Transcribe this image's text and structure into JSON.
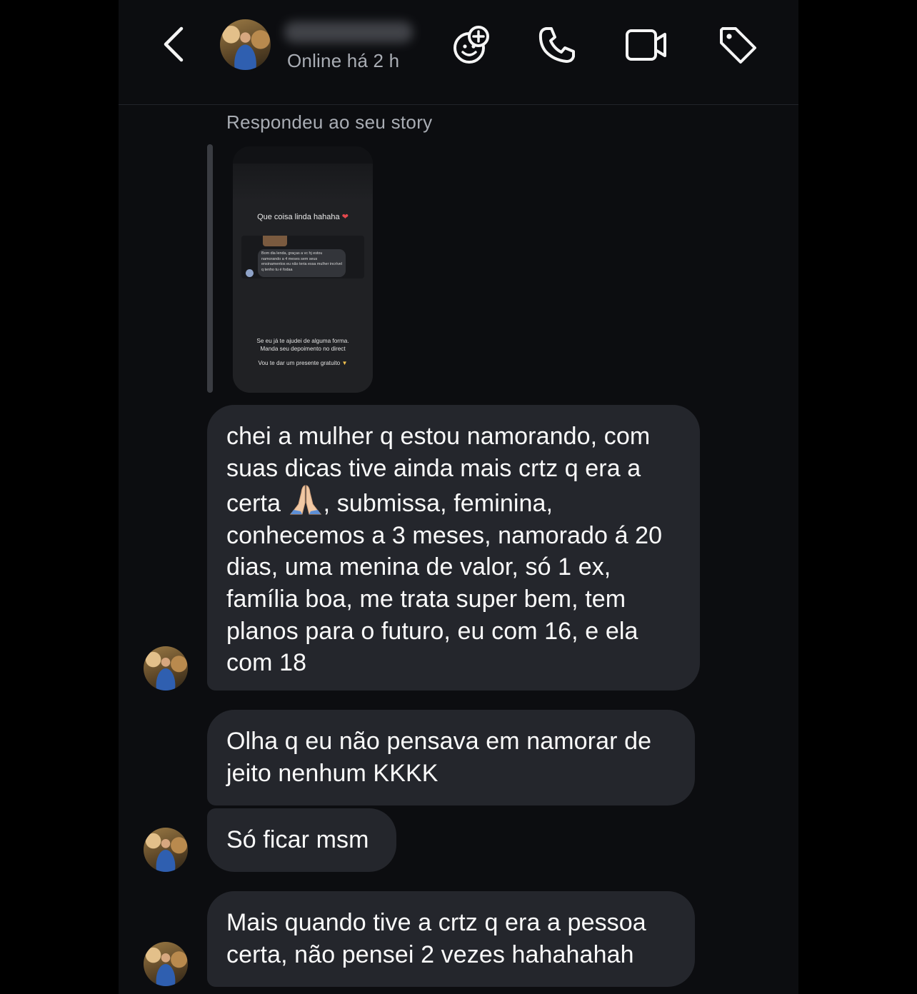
{
  "header": {
    "status": "Online há 2 h",
    "icons": [
      "back-chevron-icon",
      "add-effect-icon",
      "phone-icon",
      "video-call-icon",
      "tag-icon"
    ]
  },
  "reply": {
    "label": "Respondeu ao seu story"
  },
  "story": {
    "title": "Que coisa linda hahaha",
    "dm_text": "Bom dia lenda, graças a vc hj estou namorando a 4 meses sem seus ensinamentos eu não teria essa mulher incrível q tenho tu é fodaa",
    "footer_line1": "Se eu já te ajudei de alguma forma.",
    "footer_line2": "Manda seu depoimento no direct",
    "footer_line3": "Vou te dar um presente gratuito"
  },
  "messages": [
    {
      "before": "chei a mulher q estou namorando, com suas dicas tive ainda mais crtz q era a certa",
      "emoji": "folded-hands",
      "after": ", submissa, feminina, conhecemos a 3 meses, namorado á 20 dias, uma menina de valor, só 1 ex, família boa, me trata super bem, tem planos para o futuro, eu com 16, e ela com 18"
    },
    {
      "text": "Olha q eu não pensava em namorar de jeito nenhum KKKK"
    },
    {
      "text": "Só ficar msm"
    },
    {
      "text": "Mais quando tive a crtz q era a pessoa certa, não pensei 2 vezes hahahahah"
    }
  ],
  "colors": {
    "background": "#0c0d10",
    "bubble": "#24262c",
    "muted_text": "#a9adb4"
  }
}
